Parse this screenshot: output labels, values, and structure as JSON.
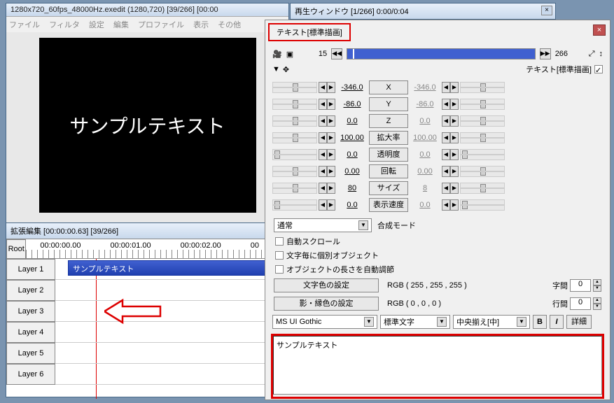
{
  "main": {
    "title": "1280x720_60fps_48000Hz.exedit  (1280,720)  [39/266]  [00:00",
    "menu": [
      "ファイル",
      "フィルタ",
      "設定",
      "編集",
      "プロファイル",
      "表示",
      "その他"
    ],
    "preview_text": "サンプルテキスト"
  },
  "playback": {
    "title": "再生ウィンドウ  [1/266]  0:00/0:04"
  },
  "timeline": {
    "title": "拡張編集 [00:00:00.63] [39/266]",
    "root": "Root",
    "times": [
      "00:00:00.00",
      "00:00:01.00",
      "00:00:02.00",
      "00"
    ],
    "layers": [
      "Layer 1",
      "Layer 2",
      "Layer 3",
      "Layer 4",
      "Layer 5",
      "Layer 6"
    ],
    "object_label": "サンプルテキスト"
  },
  "prop": {
    "tab": "テキスト[標準描画]",
    "frame_start": "15",
    "frame_end": "266",
    "type_label": "テキスト[標準描画]",
    "params": [
      {
        "left": "-346.0",
        "label": "X",
        "right": "-346.0"
      },
      {
        "left": "-86.0",
        "label": "Y",
        "right": "-86.0"
      },
      {
        "left": "0.0",
        "label": "Z",
        "right": "0.0"
      },
      {
        "left": "100.00",
        "label": "拡大率",
        "right": "100.00"
      },
      {
        "left": "0.0",
        "label": "透明度",
        "right": "0.0"
      },
      {
        "left": "0.00",
        "label": "回転",
        "right": "0.00"
      },
      {
        "left": "80",
        "label": "サイズ",
        "right": "8"
      },
      {
        "left": "0.0",
        "label": "表示速度",
        "right": "0.0"
      }
    ],
    "blend_mode_label": "合成モード",
    "blend_mode": "通常",
    "checks": [
      "自動スクロール",
      "文字毎に個別オブジェクト",
      "オブジェクトの長さを自動調節"
    ],
    "text_color_btn": "文字色の設定",
    "text_color_rgb": "RGB ( 255 , 255 , 255 )",
    "shadow_color_btn": "影・縁色の設定",
    "shadow_color_rgb": "RGB ( 0 , 0 , 0 )",
    "char_spacing_label": "字間",
    "char_spacing": "0",
    "line_spacing_label": "行間",
    "line_spacing": "0",
    "font": "MS UI Gothic",
    "font_style": "標準文字",
    "align": "中央揃え[中]",
    "bold": "B",
    "italic": "I",
    "detail": "詳細",
    "text_content": "サンプルテキスト"
  }
}
